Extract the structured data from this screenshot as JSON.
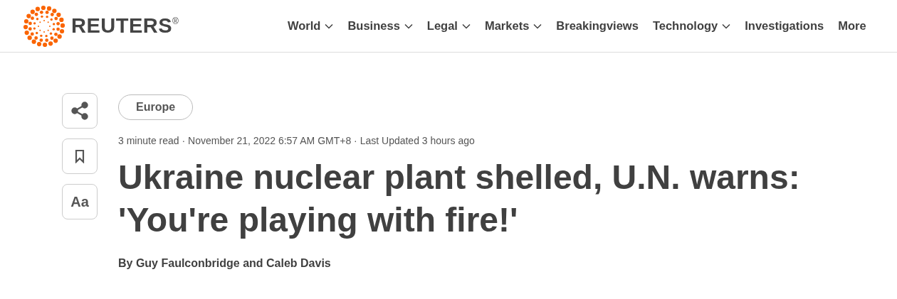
{
  "header": {
    "logo": {
      "wordmark": "REUTERS",
      "mark": "®"
    },
    "nav": [
      {
        "label": "World",
        "has_menu": true
      },
      {
        "label": "Business",
        "has_menu": true
      },
      {
        "label": "Legal",
        "has_menu": true
      },
      {
        "label": "Markets",
        "has_menu": true
      },
      {
        "label": "Breakingviews",
        "has_menu": false
      },
      {
        "label": "Technology",
        "has_menu": true
      },
      {
        "label": "Investigations",
        "has_menu": false
      },
      {
        "label": "More",
        "has_menu": false
      }
    ]
  },
  "tools": [
    {
      "kind": "share"
    },
    {
      "kind": "bookmark"
    },
    {
      "kind": "text",
      "label": "Aa"
    }
  ],
  "article": {
    "section": "Europe",
    "meta": "3 minute read · November 21, 2022 6:57 AM GMT+8 · Last Updated 3 hours ago",
    "headline_lines": [
      "Ukraine nuclear plant shelled, U.N. warns:",
      "'You're playing with fire!'"
    ],
    "byline": "By Guy Faulconbridge and Caleb Davis"
  }
}
